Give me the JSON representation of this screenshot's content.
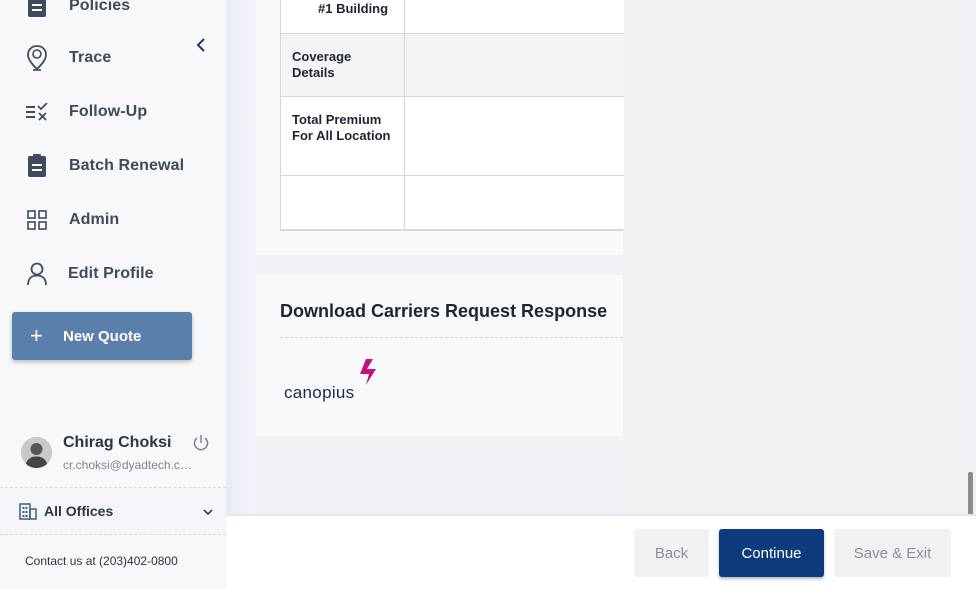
{
  "sidebar": {
    "items": [
      {
        "label": "Policies",
        "icon": "clipboard-icon"
      },
      {
        "label": "Trace",
        "icon": "location-pin-icon"
      },
      {
        "label": "Follow-Up",
        "icon": "list-check-icon"
      },
      {
        "label": "Batch Renewal",
        "icon": "clipboard-icon"
      },
      {
        "label": "Admin",
        "icon": "grid-icon"
      },
      {
        "label": "Edit Profile",
        "icon": "user-icon"
      }
    ],
    "new_quote_label": "New Quote",
    "user": {
      "name": "Chirag Choksi",
      "email": "cr.choksi@dyadtech.com"
    },
    "offices_label": "All Offices",
    "contact": "Contact us at (203)402-0800"
  },
  "table": {
    "rows": [
      {
        "label": "#1 Building"
      },
      {
        "label": "Coverage Details"
      },
      {
        "label": "Total Premium For All Location"
      },
      {
        "label": ""
      }
    ]
  },
  "download": {
    "title": "Download Carriers Request Response",
    "carrier": "canopius"
  },
  "footer": {
    "back_label": "Back",
    "continue_label": "Continue",
    "save_exit_label": "Save & Exit"
  },
  "colors": {
    "primary": "#0d3b7e",
    "new_quote": "#5b7fab",
    "canopius_accent": "#c0147a"
  }
}
